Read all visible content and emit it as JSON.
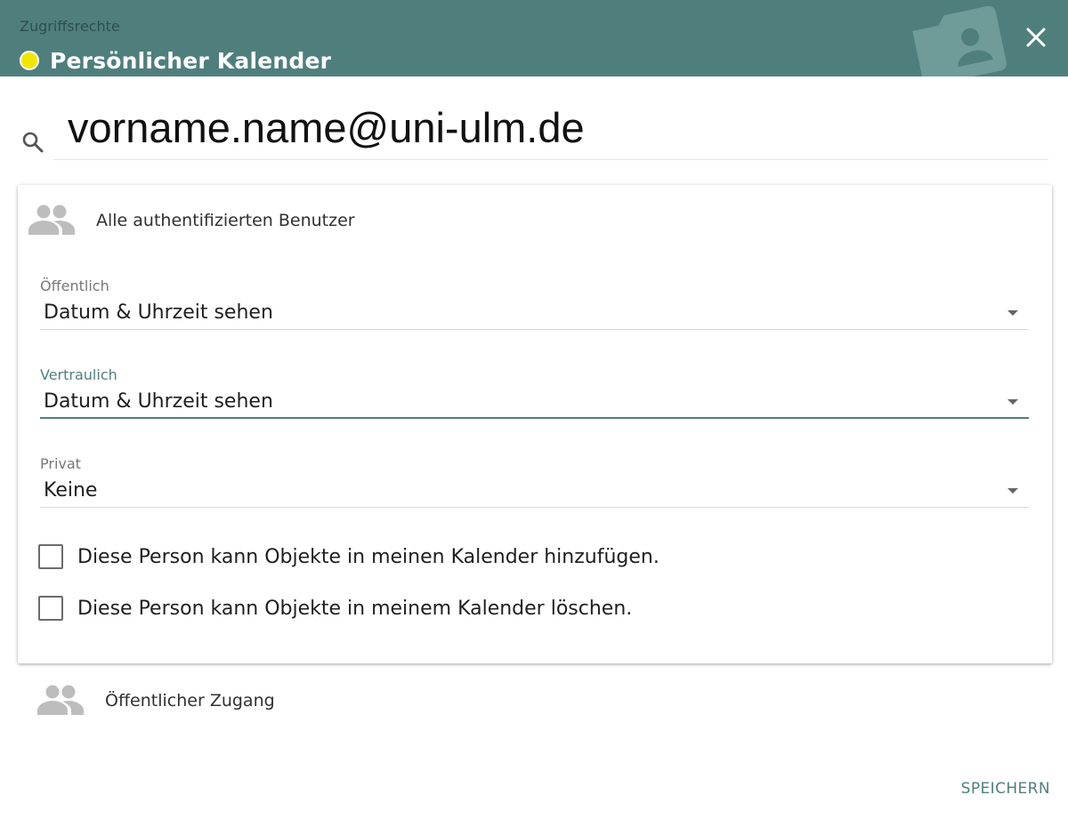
{
  "header": {
    "subtitle": "Zugriffsrechte",
    "title": "Persönlicher Kalender",
    "calendar_color": "#f2e600",
    "background_color": "#4f7f7d",
    "close_icon": "close-icon",
    "decor_icon": "folder-user-icon"
  },
  "search": {
    "value": "vorname.name@uni-ulm.de",
    "icon": "search-icon"
  },
  "permissions": [
    {
      "principal": "Alle authentifizierten Benutzer",
      "icon": "people-icon",
      "fields": [
        {
          "label": "Öffentlich",
          "value": "Datum & Uhrzeit sehen",
          "focused": false
        },
        {
          "label": "Vertraulich",
          "value": "Datum & Uhrzeit sehen",
          "focused": true
        },
        {
          "label": "Privat",
          "value": "Keine",
          "focused": false
        }
      ],
      "checkboxes": [
        {
          "label": "Diese Person kann Objekte in meinen Kalender hinzufügen.",
          "checked": false
        },
        {
          "label": "Diese Person kann Objekte in meinem Kalender löschen.",
          "checked": false
        }
      ]
    },
    {
      "principal": "Öffentlicher Zugang",
      "icon": "people-icon"
    }
  ],
  "footer": {
    "save_label": "SPEICHERN"
  }
}
